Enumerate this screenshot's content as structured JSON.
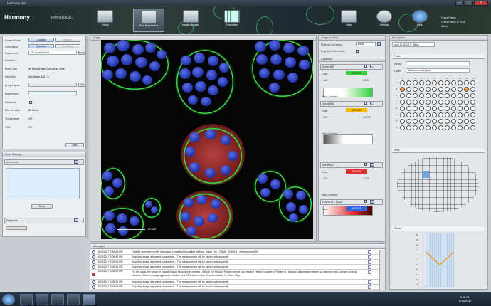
{
  "window": {
    "title": "Harmony 4.5"
  },
  "app": {
    "logo": "Harmony",
    "sublogo": "PhenoLOGIC"
  },
  "toolbar": {
    "buttons": [
      {
        "label": "Setup"
      },
      {
        "label": "Run Experiment"
      },
      {
        "label": "Image Analysis"
      },
      {
        "label": "Evaluation"
      },
      {
        "label": "Data"
      },
      {
        "label": "Settings"
      },
      {
        "label": "Help"
      }
    ],
    "user": [
      "Opera Phenix",
      "Opera Phenix 1/ 2016",
      "Admin"
    ]
  },
  "left": {
    "control_mode_label": "Control Mode",
    "control_mode_value": "Loaded",
    "control_mode_other": "Remote",
    "scan_mode_label": "Scan Mode",
    "scan_mode_value": "Standard",
    "scan_mode_other": "PreciScan",
    "experiment_label": "Experiment",
    "experiment_value": "*3D spheroid test",
    "experiment_btn": "Load",
    "date_job_label": "Date/Job",
    "plate_type_label": "Plate Type",
    "plate_type_value": "96 PhenoPlate CellCarrier Ultra",
    "objective_label": "Objective",
    "objective_value": "40x Water, NA 1.1",
    "array_layout_label": "Array Layout",
    "array_btn": "Edit",
    "plate_name_label": "Plate Name",
    "shutdown_label": "Shutdown",
    "max_duration_label": "Max Duration",
    "max_duration_value": "8h 00min",
    "temperature_label": "Temperature",
    "temperature_value": "Off",
    "co2_label": "CO2",
    "co2_value": "Off",
    "start_btn": "Start",
    "plate_settings": "Plate Settings",
    "comment_label": "Comment",
    "reset_btn": "Reset",
    "keywords_label": "Keywords"
  },
  "image": {
    "header": "Image",
    "scalebar": "50 µm"
  },
  "image_control": {
    "header": "Image Control",
    "flatfield_label": "Flatfield Correction",
    "flatfield_value": "Basic",
    "brightfield_label": "Brightfield Correction",
    "channels_header": "Channels",
    "channels": [
      {
        "name": "Alexa 488",
        "color_label": "Color",
        "hex": "#00FF00",
        "lo": "146",
        "hi": "4000",
        "auto": "Auto Contrast",
        "swatch": "#36d13a"
      },
      {
        "name": "Alexa 568",
        "color_label": "Color",
        "hex": "#FFC200",
        "lo": "231",
        "hi": "19,770",
        "auto": "Auto Contrast",
        "swatch": "#f5b800"
      },
      {
        "name": "Alexa 647",
        "color_label": "Color",
        "hex": "#FF0000",
        "lo": "270",
        "hi": "2,000",
        "auto": "Auto Contrast",
        "swatch": "#e03030"
      },
      {
        "name": "HOECHST 33342",
        "color_label": "Color",
        "hex": "#0070FF",
        "lo": "",
        "hi": "",
        "auto": "",
        "swatch": "#2f66e0"
      }
    ]
  },
  "navigation": {
    "header": "Navigation",
    "tab": "aunt 2016/2017 - Mea...",
    "plate_header": "Plate",
    "assay_label": "Assay",
    "layer_label": "Layer",
    "layer_value": "Measurement Layout",
    "rows": [
      "A",
      "B",
      "C",
      "D",
      "E",
      "F",
      "G",
      "H"
    ],
    "cols": [
      "1",
      "2",
      "3",
      "4",
      "5",
      "6",
      "7",
      "8",
      "9",
      "10",
      "11",
      "12"
    ],
    "well_header": "Well",
    "stack_header": "Stack",
    "stack_ticks": [
      "20",
      "16",
      "12",
      "8",
      "4",
      "0",
      "-4",
      "-8",
      "-12",
      "-16",
      "-20"
    ]
  },
  "messages": {
    "header": "Messages",
    "rows": [
      {
        "ts": "6/28/2017 2:49:36 PM",
        "text": "Flatfield correction profile estimation completed (available method: 'Basic') for 170628_3D5H9-1 - Measurement 2b"
      },
      {
        "ts": "6/28/2017 3:06:47 PM",
        "text": "Acquiring image alignment parameters... The measurement will be started subsequently."
      },
      {
        "ts": "6/28/2017 3:20:03 PM",
        "text": "Acquiring image alignment parameters... The measurement will be started subsequently."
      },
      {
        "ts": "6/28/2017 3:25:30 PM",
        "text": "Acquiring image alignment parameters... The measurement will be started subsequently."
      },
      {
        "ts": "6/28/2017 3:28:22 PM",
        "text": "For the stack, the range of possible focus heights is exceeded (-999µm to +50 µm). Please correct your input in Height, Number of Planes or Distance. Alternatively select an objective with a longer working distance. If this message appears in relation to a DPC channel see Troubleshooting in Online Help."
      },
      {
        "ts": "6/28/2017 3:28:22 PM",
        "text": "Acquiring image alignment parameters... The measurement will be started subsequently."
      },
      {
        "ts": "6/28/2017 3:29:08 PM",
        "text": "Acquiring image alignment parameters... The measurement will be started subsequently."
      },
      {
        "ts": "6/28/2017 3:30:14 PM",
        "text": "Acquiring image alignment parameters... The measurement will be started subsequently."
      }
    ]
  },
  "taskbar": {
    "time": "3:35 PM",
    "date": "6/28/2017"
  }
}
